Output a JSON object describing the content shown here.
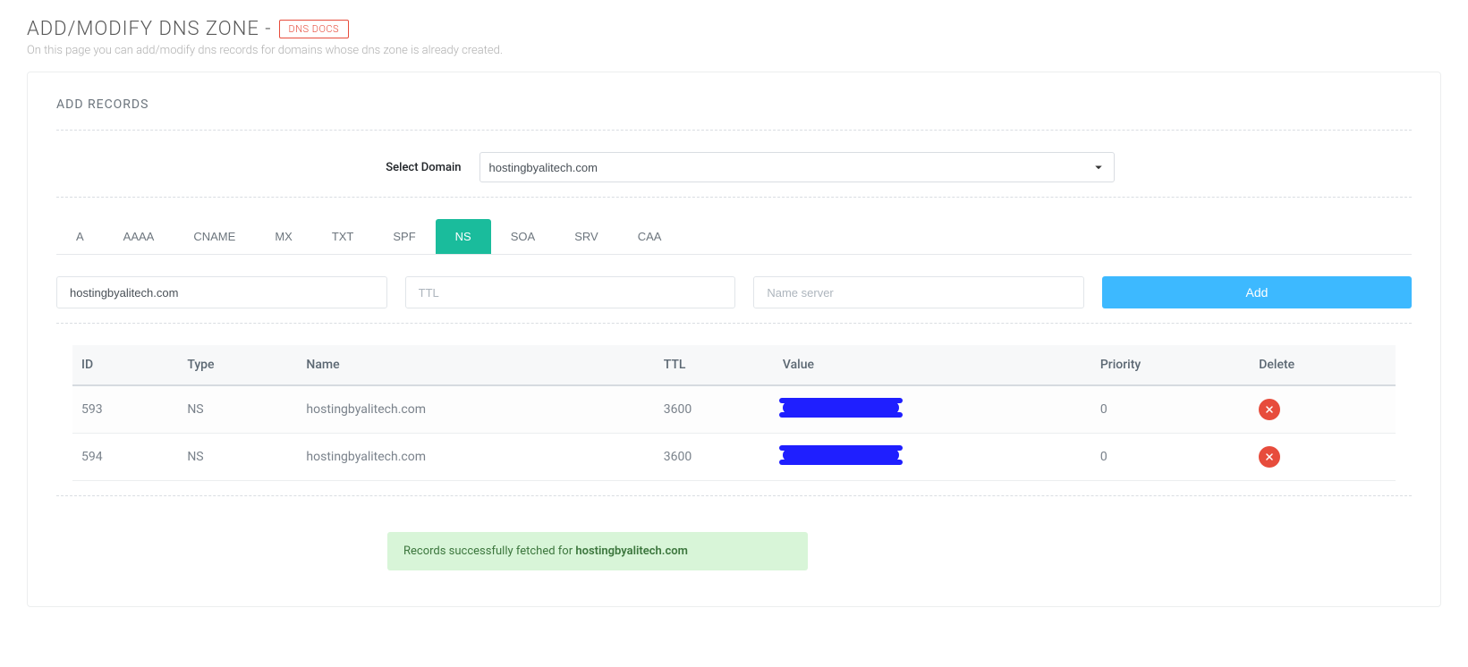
{
  "header": {
    "title": "ADD/MODIFY DNS ZONE -",
    "docs_label": "DNS DOCS",
    "subtitle": "On this page you can add/modify dns records for domains whose dns zone is already created."
  },
  "section": {
    "title": "ADD RECORDS",
    "domain_label": "Select Domain",
    "selected_domain": "hostingbyalitech.com"
  },
  "tabs": [
    {
      "label": "A",
      "active": false
    },
    {
      "label": "AAAA",
      "active": false
    },
    {
      "label": "CNAME",
      "active": false
    },
    {
      "label": "MX",
      "active": false
    },
    {
      "label": "TXT",
      "active": false
    },
    {
      "label": "SPF",
      "active": false
    },
    {
      "label": "NS",
      "active": true
    },
    {
      "label": "SOA",
      "active": false
    },
    {
      "label": "SRV",
      "active": false
    },
    {
      "label": "CAA",
      "active": false
    }
  ],
  "form": {
    "host_value": "hostingbyalitech.com",
    "ttl_placeholder": "TTL",
    "ns_placeholder": "Name server",
    "add_label": "Add"
  },
  "table": {
    "headers": {
      "id": "ID",
      "type": "Type",
      "name": "Name",
      "ttl": "TTL",
      "value": "Value",
      "priority": "Priority",
      "delete": "Delete"
    },
    "rows": [
      {
        "id": "593",
        "type": "NS",
        "name": "hostingbyalitech.com",
        "ttl": "3600",
        "value": "[redacted]",
        "priority": "0"
      },
      {
        "id": "594",
        "type": "NS",
        "name": "hostingbyalitech.com",
        "ttl": "3600",
        "value": "[redacted]",
        "priority": "0"
      }
    ]
  },
  "alert": {
    "prefix": "Records successfully fetched for ",
    "domain": "hostingbyalitech.com"
  }
}
